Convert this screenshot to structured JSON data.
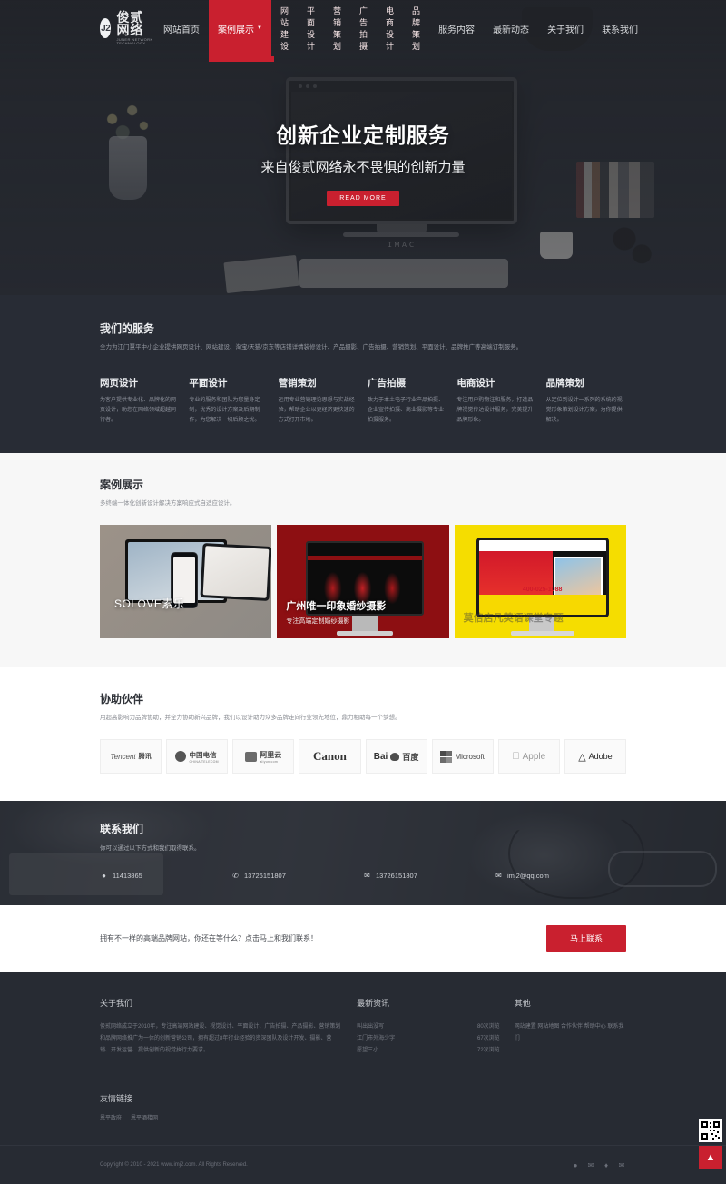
{
  "brand": {
    "mark": "J2",
    "name_cn": "俊贰网络",
    "name_en": "JUNER NETWORK TECHNOLOGY"
  },
  "nav": {
    "items": [
      {
        "label": "网站首页",
        "active": false,
        "has_dropdown": false
      },
      {
        "label": "案例展示",
        "active": true,
        "has_dropdown": true
      },
      {
        "label": "服务内容",
        "active": false,
        "has_dropdown": false
      },
      {
        "label": "最新动态",
        "active": false,
        "has_dropdown": false
      },
      {
        "label": "关于我们",
        "active": false,
        "has_dropdown": false
      },
      {
        "label": "联系我们",
        "active": false,
        "has_dropdown": false
      }
    ],
    "dropdown": [
      "网站建设",
      "平面设计",
      "营销策划",
      "广告拍摄",
      "电商设计",
      "品牌策划"
    ]
  },
  "hero": {
    "title": "创新企业定制服务",
    "subtitle": "来自俊贰网络永不畏惧的创新力量",
    "button": "READ MORE",
    "monitor_brand": "ＩＭＡＣ"
  },
  "services": {
    "heading": "我们的服务",
    "subheading": "全力为江门慧平中小企业提供网页设计、网站建设、淘宝/天猫/京东等店铺详情装修设计、产品摄影、广告拍摄、营销策划、平面设计、品牌推广等高端订制服务。",
    "items": [
      {
        "title": "网页设计",
        "desc": "为客户提供专业化、品牌化的网页设计，助您在网络领域超越同行者。"
      },
      {
        "title": "平面设计",
        "desc": "专业的服务和团队为您量身定制，优秀的设计方案及后期制作，为您解决一切后顾之忧。"
      },
      {
        "title": "营销策划",
        "desc": "运用专业营销理论思想与实战经验，帮助企业以更经济更快速的方式打开市场。"
      },
      {
        "title": "广告拍摄",
        "desc": "致力于本土电子行业产品拍摄、企业宣传拍摄、商业摄影等专业拍摄服务。"
      },
      {
        "title": "电商设计",
        "desc": "专注用户购物注和服务，打造品牌视觉传达设计服务，完美提升品牌形象。"
      },
      {
        "title": "品牌策划",
        "desc": "从定位到设计一系列的系统的视觉形象策划设计方案，为你提供解决。"
      }
    ]
  },
  "cases": {
    "heading": "案例展示",
    "subheading": "多终端一体化创新设计解决方案响应式自适应设计。",
    "items": [
      {
        "title": "SOLOVE素乐",
        "subtitle": ""
      },
      {
        "title": "广州唯一印象婚纱摄影",
        "subtitle": "专注高端定制婚纱摄影"
      },
      {
        "title": "莫倍店凡英语课堂专题",
        "subtitle": "",
        "phone": "400-025-1088"
      }
    ]
  },
  "partners": {
    "heading": "协助伙伴",
    "subheading": "用超高影响力品牌协助，并全力协助新兴品牌，我们以设计助力众多品牌走向行业领先地位，鼎力相助每一个梦想。",
    "logos": [
      {
        "name": "Tencent",
        "cn": "腾讯",
        "sub": ""
      },
      {
        "name": "",
        "cn": "中国电信",
        "sub": "CHINA TELECOM"
      },
      {
        "name": "",
        "cn": "阿里云",
        "sub": "aliyun.com"
      },
      {
        "name": "Canon",
        "cn": "",
        "sub": ""
      },
      {
        "name": "Bai",
        "cn": "百度",
        "sub": ""
      },
      {
        "name": "Microsoft",
        "cn": "",
        "sub": ""
      },
      {
        "name": "Apple",
        "cn": "",
        "sub": ""
      },
      {
        "name": "Adobe",
        "cn": "",
        "sub": ""
      }
    ]
  },
  "contact": {
    "heading": "联系我们",
    "subheading": "你可以通过以下方式和我们取得联系。",
    "items": [
      {
        "icon": "qq-icon",
        "value": "11413865"
      },
      {
        "icon": "phone-icon",
        "value": "13726151807"
      },
      {
        "icon": "wechat-icon",
        "value": "13726151807"
      },
      {
        "icon": "mail-icon",
        "value": "imj2@qq.com"
      }
    ]
  },
  "cta": {
    "text": "拥有不一样的高端品牌网站，你还在等什么？点击马上和我们联系！",
    "button": "马上联系"
  },
  "footer": {
    "about": {
      "heading": "关于我们",
      "text": "俊贰网络成立于2010年，专注高端网站建设、视觉设计、平面设计、广告拍摄、产品摄影、营销策划和品牌网络推广为一体的创新营销公司，拥有超过8年行业经验的资深团队及设计开发、摄影、营销、开发运营、提供创新的视觉执行力要求。"
    },
    "news": {
      "heading": "最新资讯",
      "items": [
        {
          "title": "叫出出没写",
          "views": "80次浏览"
        },
        {
          "title": "江门市外海少字",
          "views": "67次浏览"
        },
        {
          "title": "愿望三小",
          "views": "72次浏览"
        }
      ]
    },
    "other": {
      "heading": "其他",
      "links": "网站建置 网站地图 合作伙伴 帮助中心 联系我们"
    },
    "friend": {
      "heading": "友情链接",
      "items": [
        "恩平政府",
        "恩平酒楼网"
      ]
    },
    "copyright": "Copyright © 2010 - 2021 www.imj2.com. All Rights Reserved.",
    "social": [
      "weibo-icon",
      "wechat-icon",
      "rss-icon",
      "mail-icon"
    ]
  },
  "widgets": {
    "qr": "qrcode-icon",
    "to_top": "▲"
  }
}
